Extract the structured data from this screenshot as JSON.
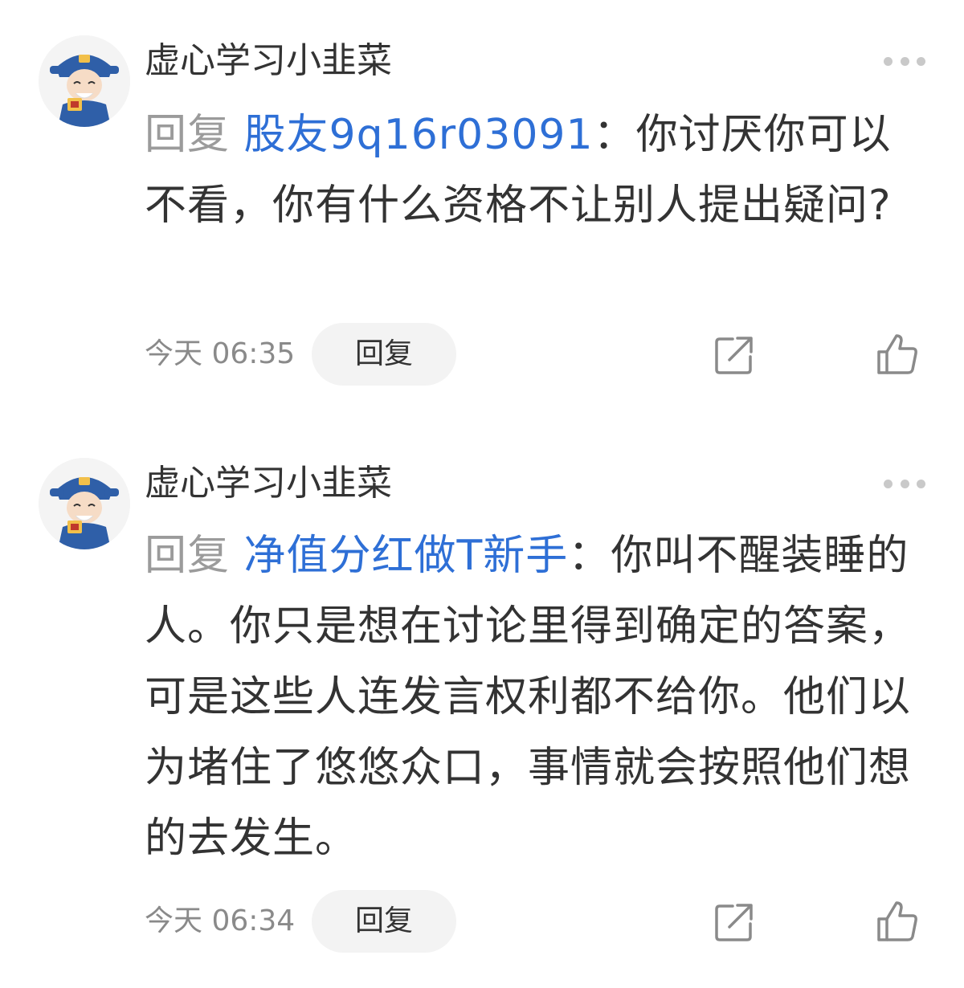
{
  "comments": [
    {
      "username": "虚心学习小韭菜",
      "reply_prefix": "回复 ",
      "mention": "股友9q16r03091",
      "colon": "：",
      "text": "你讨厌你可以不看，你有什么资格不让别人提出疑问?",
      "time": "今天 06:35",
      "reply_label": "回复",
      "avatar_icon": "fortune-god-avatar",
      "more_icon": "more-dots-icon",
      "share_icon": "share-icon",
      "like_icon": "thumbs-up-icon"
    },
    {
      "username": "虚心学习小韭菜",
      "reply_prefix": "回复 ",
      "mention": "净值分红做T新手",
      "colon": "：",
      "text": "你叫不醒装睡的人。你只是想在讨论里得到确定的答案，可是这些人连发言权利都不给你。他们以为堵住了悠悠众口，事情就会按照他们想的去发生。",
      "time": "今天 06:34",
      "reply_label": "回复",
      "avatar_icon": "fortune-god-avatar",
      "more_icon": "more-dots-icon",
      "share_icon": "share-icon",
      "like_icon": "thumbs-up-icon"
    }
  ],
  "colors": {
    "mention": "#2e6fd6",
    "reply_prefix": "#9b9b9b",
    "text": "#333333",
    "meta": "#8a8a8a",
    "button_bg": "#f3f3f3"
  }
}
